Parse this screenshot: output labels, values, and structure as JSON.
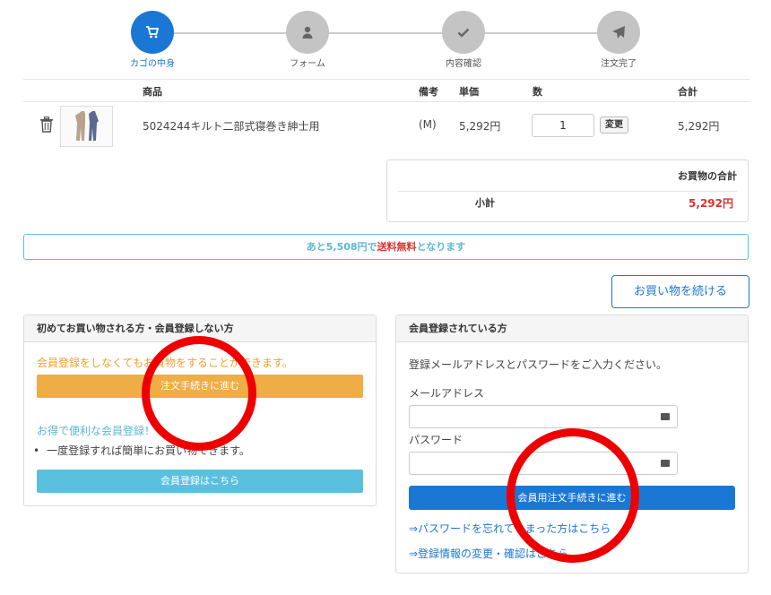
{
  "steps": [
    {
      "label": "カゴの中身",
      "icon": "cart-icon",
      "active": true
    },
    {
      "label": "フォーム",
      "icon": "user-icon",
      "active": false
    },
    {
      "label": "内容確認",
      "icon": "check-icon",
      "active": false
    },
    {
      "label": "注文完了",
      "icon": "send-icon",
      "active": false
    }
  ],
  "cart": {
    "headers": {
      "product": "商品",
      "note": "備考",
      "unit_price": "単価",
      "qty": "数",
      "total": "合計"
    },
    "item": {
      "name": "5024244キルト二部式寝巻き紳士用",
      "note": "(M)",
      "unit_price": "5,292円",
      "qty": "1",
      "change_label": "変更",
      "total": "5,292円"
    }
  },
  "summary": {
    "title": "お買物の合計",
    "subtotal_label": "小計",
    "subtotal_value": "5,292円"
  },
  "shipping": {
    "prefix": "あと5,508円で",
    "highlight": "送料無料",
    "suffix": "となります"
  },
  "continue_label": "お買い物を続ける",
  "guest": {
    "title": "初めてお買い物される方・会員登録しない方",
    "note": "会員登録をしなくてもお買物をすることができます。",
    "order_label": "注文手続きに進む",
    "benefit": "お得で便利な会員登録！",
    "bullet": "一度登録すれば簡単にお買い物できます。",
    "register_label": "会員登録はこちら"
  },
  "member": {
    "title": "会員登録されている方",
    "intro": "登録メールアドレスとパスワードをご入力ください。",
    "email_label": "メールアドレス",
    "password_label": "パスワード",
    "submit_label": "会員用注文手続きに進む",
    "forgot_link": "⇒パスワードを忘れてしまった方はこちら",
    "change_link": "⇒登録情報の変更・確認はこちら"
  },
  "colors": {
    "primary": "#1a77d3",
    "orange": "#efad45",
    "cyan": "#5bc0de",
    "alert": "#e03030",
    "annotation": "#ee0000"
  }
}
